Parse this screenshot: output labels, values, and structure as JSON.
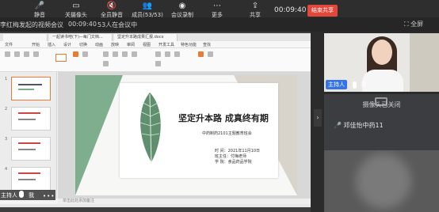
{
  "toolbar": {
    "mute_label": "静音",
    "camera_label": "关摄像头",
    "mute_all_label": "全员静音",
    "members_label": "成员(53/53)",
    "record_label": "会议录制",
    "more_label": "更多",
    "share_label": "共享",
    "clock": "00:09:40",
    "end_label": "结束共享"
  },
  "subbar": {
    "title": "李红梅发起的视频会议",
    "clock": "00:09:40",
    "count": "53人在会议中",
    "fullscreen_label": "全屏"
  },
  "wps": {
    "tabs": [
      "",
      "一起读书吧(下)—每门文档...",
      "坚定升本路成果汇报.docx"
    ],
    "menu": [
      "文件",
      "开始",
      "插入",
      "设计",
      "切换",
      "动画",
      "放映",
      "审阅",
      "视图",
      "开发工具",
      "特色功能",
      "查找"
    ],
    "notes": "单击此处添加备注",
    "slide": {
      "title": "坚定升本路 成真终有期",
      "subtitle": "中药制药2101主题教育班会",
      "time_line": "时   间：2021年11月10日",
      "teacher_line": "班主任：付梅老师",
      "school_line": "学   院：食品药品学院"
    },
    "thumb_numbers": [
      "1",
      "2",
      "3",
      "4"
    ]
  },
  "host_overlay": {
    "tag": "主持人",
    "me": "我"
  },
  "videos": [
    {
      "tag": "主持人",
      "me": "我"
    },
    {
      "status": "摄像头已关闭",
      "name": "邓佳怡中药11"
    },
    {}
  ],
  "colors": {
    "end_button": "#e1483b",
    "host_tag": "#3673e8",
    "slide_accent": "#7fae8e"
  }
}
